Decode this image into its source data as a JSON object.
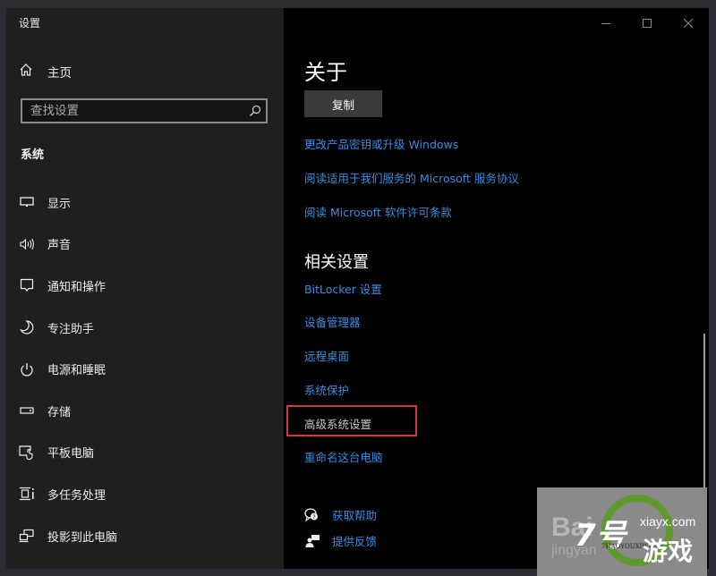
{
  "window": {
    "title": "设置",
    "controls": {
      "minimize": "minimize-icon",
      "maximize": "maximize-icon",
      "close": "close-icon"
    }
  },
  "sidebar": {
    "home": {
      "label": "主页",
      "icon": "home-icon"
    },
    "search": {
      "placeholder": "查找设置",
      "value": "",
      "icon": "search-icon"
    },
    "section_title": "系统",
    "items": [
      {
        "label": "显示",
        "icon": "monitor-icon"
      },
      {
        "label": "声音",
        "icon": "speaker-icon"
      },
      {
        "label": "通知和操作",
        "icon": "notification-icon"
      },
      {
        "label": "专注助手",
        "icon": "moon-icon"
      },
      {
        "label": "电源和睡眠",
        "icon": "power-icon"
      },
      {
        "label": "存储",
        "icon": "storage-icon"
      },
      {
        "label": "平板电脑",
        "icon": "tablet-icon"
      },
      {
        "label": "多任务处理",
        "icon": "multitasking-icon"
      },
      {
        "label": "投影到此电脑",
        "icon": "project-icon"
      }
    ]
  },
  "main": {
    "heading": "关于",
    "copy_button": "复制",
    "links": [
      "更改产品密钥或升级 Windows",
      "阅读适用于我们服务的 Microsoft 服务协议",
      "阅读 Microsoft 软件许可条款"
    ],
    "related": {
      "heading": "相关设置",
      "links": [
        "BitLocker 设置",
        "设备管理器",
        "远程桌面",
        "系统保护",
        "高级系统设置",
        "重命名这台电脑"
      ],
      "highlighted_index": 4
    },
    "help": [
      {
        "label": "获取帮助",
        "icon": "help-chat-icon"
      },
      {
        "label": "提供反馈",
        "icon": "feedback-icon"
      }
    ],
    "accent_color": "#3c8ce0",
    "highlight_color": "#d2373f"
  },
  "watermark": {
    "baidu": "Bai",
    "jingyan": "jingyan",
    "site": "xiayx.com",
    "num": "7号",
    "game": "游戏",
    "sub": "7HAOYOUXIWANG"
  }
}
